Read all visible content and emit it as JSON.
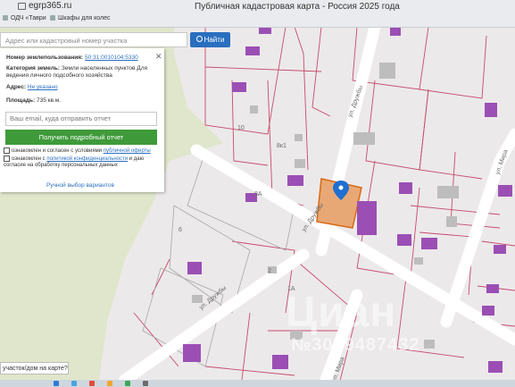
{
  "browser": {
    "url": "egrp365.ru",
    "tab_title": "Публичная кадастровая карта - Россия 2025 года",
    "bookmarks": [
      "ОДЧ «Таври",
      "Шкафы для колес"
    ]
  },
  "search": {
    "placeholder": "Адрес или кадастровый номер участка",
    "button_label": "Найти"
  },
  "info_panel": {
    "cadastral_label": "Номер землепользования:",
    "cadastral_value": "50:31:0010104:5330",
    "category_label": "Категория земель:",
    "category_value": "Земли населенных пунктов Для ведения личного подсобного хозяйства",
    "address_label": "Адрес:",
    "address_value": "Не указано",
    "area_label": "Площадь:",
    "area_value": "735 кв.м.",
    "email_placeholder": "Ваш email, куда отправить отчет",
    "report_button": "Получить подробный отчет",
    "consent_1_prefix": "ознакомлен и согласен с условиями",
    "consent_1_link": "публичной оферты",
    "consent_2_prefix": "ознакомлен с",
    "consent_2_link": "политикой конфиденциальности",
    "consent_2_suffix": "и даю согласие на обработку персональных данных",
    "manual_link": "Ручной выбор вариантов"
  },
  "map": {
    "street_labels": [
      "ул. Дружбы",
      "ул. Дружбы",
      "ул. Мира",
      "ул. Мира",
      "ул. Дружбы"
    ],
    "parcel_labels": [
      "10",
      "8к1",
      "6",
      "1А",
      "2",
      "8А"
    ],
    "selected_parcel_color": "#e8a875",
    "building_color": "#9b4fb4"
  },
  "question_box": "участок/дом на карте?",
  "watermark": {
    "logo": "Циан",
    "id": "№3019487432"
  }
}
